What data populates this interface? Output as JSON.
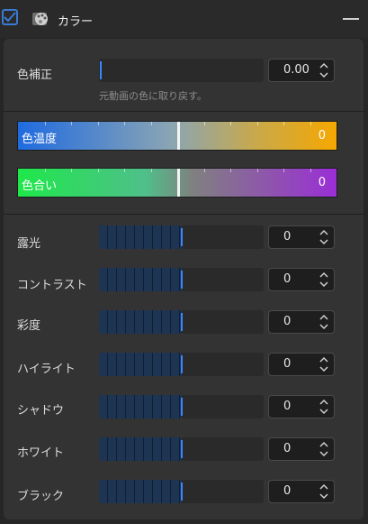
{
  "header": {
    "title": "カラー",
    "checkbox_checked": true,
    "icon": "palette-icon"
  },
  "correction": {
    "label": "色補正",
    "value": "0.00",
    "hint": "元動画の色に取り戻す。"
  },
  "gradients": [
    {
      "label": "色温度",
      "value": "0",
      "position": 0.5
    },
    {
      "label": "色合い",
      "value": "0",
      "position": 0.5
    }
  ],
  "adjustments": [
    {
      "label": "露光",
      "value": "0",
      "level": 0.5
    },
    {
      "label": "コントラスト",
      "value": "0",
      "level": 0.5
    },
    {
      "label": "彩度",
      "value": "0",
      "level": 0.5
    },
    {
      "label": "ハイライト",
      "value": "0",
      "level": 0.5
    },
    {
      "label": "シャドウ",
      "value": "0",
      "level": 0.5
    },
    {
      "label": "ホワイト",
      "value": "0",
      "level": 0.5
    },
    {
      "label": "ブラック",
      "value": "0",
      "level": 0.5
    }
  ],
  "colors": {
    "accent": "#3a86ff",
    "temp_start": "#1f6be0",
    "temp_end": "#f6a800",
    "tint_start": "#1ee84a",
    "tint_end": "#9b2ed6"
  }
}
